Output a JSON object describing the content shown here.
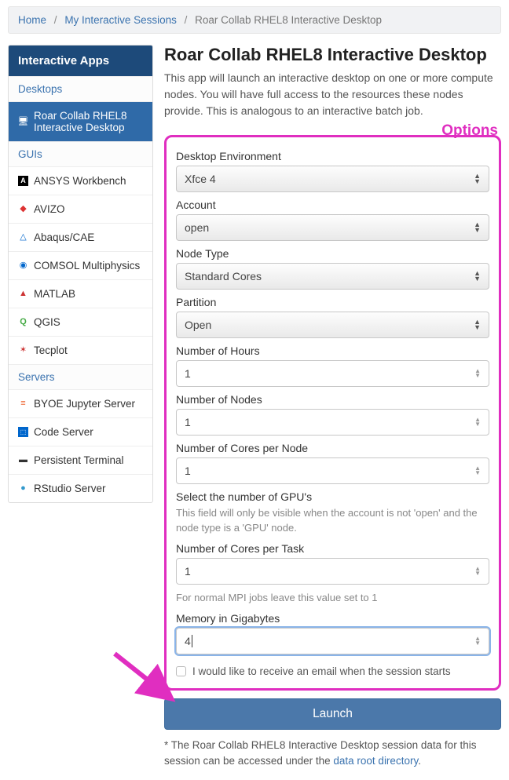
{
  "breadcrumb": {
    "home": "Home",
    "sessions": "My Interactive Sessions",
    "current": "Roar Collab RHEL8 Interactive Desktop"
  },
  "sidebar": {
    "title": "Interactive Apps",
    "sections": [
      {
        "label": "Desktops",
        "items": [
          {
            "label": "Roar Collab RHEL8 Interactive Desktop",
            "active": true
          }
        ]
      },
      {
        "label": "GUIs",
        "items": [
          {
            "label": "ANSYS Workbench"
          },
          {
            "label": "AVIZO"
          },
          {
            "label": "Abaqus/CAE"
          },
          {
            "label": "COMSOL Multiphysics"
          },
          {
            "label": "MATLAB"
          },
          {
            "label": "QGIS"
          },
          {
            "label": "Tecplot"
          }
        ]
      },
      {
        "label": "Servers",
        "items": [
          {
            "label": "BYOE Jupyter Server"
          },
          {
            "label": "Code Server"
          },
          {
            "label": "Persistent Terminal"
          },
          {
            "label": "RStudio Server"
          }
        ]
      }
    ]
  },
  "page": {
    "title": "Roar Collab RHEL8 Interactive Desktop",
    "lead": "This app will launch an interactive desktop on one or more compute nodes. You will have full access to the resources these nodes provide. This is analogous to an interactive batch job.",
    "options_tag": "Options"
  },
  "form": {
    "desktop_env": {
      "label": "Desktop Environment",
      "value": "Xfce 4"
    },
    "account": {
      "label": "Account",
      "value": "open"
    },
    "node_type": {
      "label": "Node Type",
      "value": "Standard Cores"
    },
    "partition": {
      "label": "Partition",
      "value": "Open"
    },
    "hours": {
      "label": "Number of Hours",
      "value": "1"
    },
    "nodes": {
      "label": "Number of Nodes",
      "value": "1"
    },
    "cores_node": {
      "label": "Number of Cores per Node",
      "value": "1"
    },
    "gpus": {
      "label": "Select the number of GPU's",
      "help": "This field will only be visible when the account is not 'open' and the node type is a 'GPU' node."
    },
    "cores_task": {
      "label": "Number of Cores per Task",
      "value": "1",
      "help": "For normal MPI jobs leave this value set to 1"
    },
    "memory": {
      "label": "Memory in Gigabytes",
      "value": "4"
    },
    "email": {
      "label": "I would like to receive an email when the session starts"
    },
    "launch": "Launch"
  },
  "footer": {
    "pre": "* The Roar Collab RHEL8 Interactive Desktop session data for this session can be accessed under the ",
    "link": "data root directory",
    "post": "."
  }
}
